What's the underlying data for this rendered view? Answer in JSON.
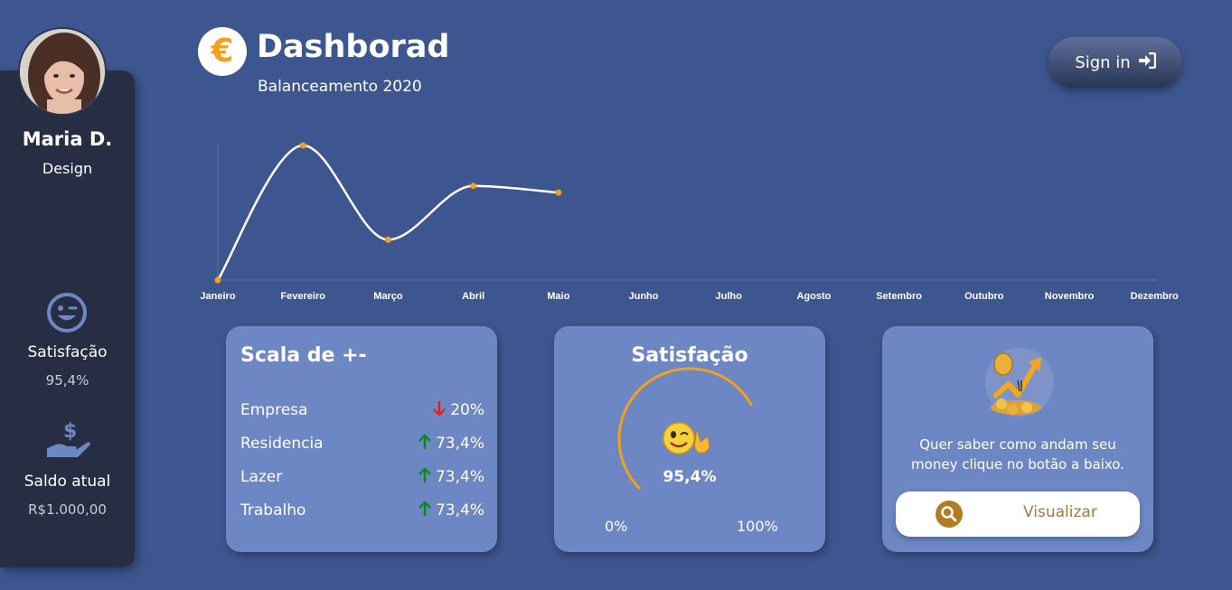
{
  "user": {
    "name": "Maria D.",
    "role": "Design"
  },
  "sidebar": {
    "satisfaction_label": "Satisfação",
    "satisfaction_value": "95,4%",
    "balance_label": "Saldo atual",
    "balance_value": "R$1.000,00",
    "icons": [
      "wink-face-icon",
      "hand-dollar-icon"
    ]
  },
  "header": {
    "logo_symbol": "€",
    "title": "Dashborad",
    "subtitle": "Balanceamento 2020",
    "signin_label": "Sign in"
  },
  "chart_data": {
    "type": "line",
    "categories": [
      "Janeiro",
      "Fevereiro",
      "Março",
      "Abril",
      "Maio",
      "Junho",
      "Julho",
      "Agosto",
      "Setembro",
      "Outubro",
      "Novembro",
      "Dezembro"
    ],
    "values": [
      0,
      100,
      30,
      70,
      65
    ],
    "ylim": [
      0,
      100
    ],
    "grid": false,
    "line_color": "#ffffff",
    "point_color": "#f4a01c"
  },
  "cards": {
    "scala": {
      "title": "Scala de +-",
      "rows": [
        {
          "label": "Empresa",
          "direction": "down",
          "value": "20%"
        },
        {
          "label": "Residencia",
          "direction": "up",
          "value": "73,4%"
        },
        {
          "label": "Lazer",
          "direction": "up",
          "value": "73,4%"
        },
        {
          "label": "Trabalho",
          "direction": "up",
          "value": "73,4%"
        }
      ]
    },
    "satisfacao": {
      "title": "Satisfação",
      "value": "95,4%",
      "gauge_fraction": 0.954,
      "min_label": "0%",
      "max_label": "100%",
      "accent": "#f4a01c"
    },
    "info": {
      "text": "Quer saber como andam seu money clique no botão a baixo.",
      "button_label": "Visualizar",
      "button_text_color": "#a47a3a"
    }
  },
  "colors": {
    "background": "#3d568f",
    "sidebar": "#272e43",
    "card": "#6d86c4",
    "accent": "#f4a01c",
    "up": "#0b8a1a",
    "down": "#e0201b"
  }
}
